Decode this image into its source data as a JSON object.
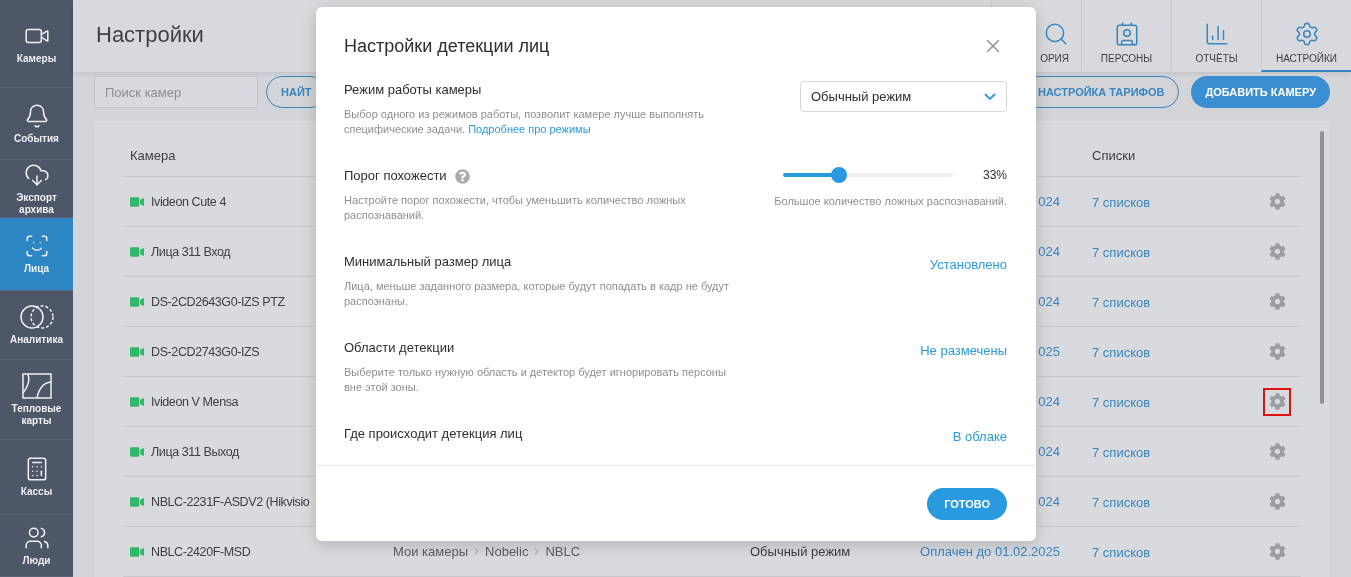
{
  "sidebar": {
    "items": [
      {
        "label": "Камеры",
        "selected": false
      },
      {
        "label": "События",
        "selected": false
      },
      {
        "label": "Экспорт архива",
        "selected": false
      },
      {
        "label": "Лица",
        "selected": true
      },
      {
        "label": "Аналитика",
        "selected": false
      },
      {
        "label": "Тепловые карты",
        "selected": false
      },
      {
        "label": "Кассы",
        "selected": false
      },
      {
        "label": "Люди",
        "selected": false
      }
    ]
  },
  "header": {
    "title": "Настройки",
    "tabs": [
      {
        "label": "ОРИЯ",
        "selected": false
      },
      {
        "label": "ПЕРСОНЫ",
        "selected": false
      },
      {
        "label": "ОТЧЁТЫ",
        "selected": false
      },
      {
        "label": "НАСТРОЙКИ",
        "selected": true
      }
    ]
  },
  "toolbar": {
    "search": {
      "placeholder": "Поиск камер"
    },
    "find_button": "НАЙТ",
    "tariff_button": "НАСТРОЙКА ТАРИФОВ",
    "add_button": "ДОБАВИТЬ КАМЕРУ"
  },
  "table": {
    "columns": [
      "Камера",
      "Списки"
    ],
    "rows": [
      {
        "camera": "Ivideon Cute 4",
        "payment": "024",
        "lists": "7 списков",
        "highlighted": false
      },
      {
        "camera": "Лица 311 Вход",
        "payment": "024",
        "lists": "7 списков",
        "highlighted": false
      },
      {
        "camera": "DS-2CD2643G0-IZS PTZ",
        "payment": "024",
        "lists": "7 списков",
        "highlighted": false
      },
      {
        "camera": "DS-2CD2743G0-IZS",
        "payment": "025",
        "lists": "7 списков",
        "highlighted": false
      },
      {
        "camera": "Ivideon V Mensa",
        "payment": "024",
        "lists": "7 списков",
        "highlighted": true
      },
      {
        "camera": "Лица 311 Выход",
        "payment": "024",
        "lists": "7 списков",
        "highlighted": false
      },
      {
        "camera": "NBLC-2231F-ASDV2 (Hikvisio",
        "payment": "024",
        "lists": "7 списков",
        "highlighted": false
      },
      {
        "camera": "NBLC-2420F-MSD",
        "path": [
          "Мои камеры",
          "Nobelic",
          "NBLC"
        ],
        "mode": "Обычный режим",
        "payment": "Оплачен до 01.02.2025",
        "lists": "7 списков",
        "highlighted": false
      }
    ]
  },
  "modal": {
    "title": "Настройки детекции лиц",
    "sections": [
      {
        "kind": "select",
        "title": "Режим работы камеры",
        "description": "Выбор одного из режимов работы, позволит камере лучше выполнять специфические задачи.",
        "link": "Подробнее про режимы",
        "value": "Обычный режим"
      },
      {
        "kind": "slider",
        "title": "Порог похожести",
        "help": true,
        "description": "Настройте порог похожести, чтобы уменьшить количество ложных распознаваний.",
        "level": 0.33,
        "reading": "33%",
        "note": "Большое количество ложных распознаваний."
      },
      {
        "kind": "link",
        "title": "Минимальный размер лица",
        "description": "Лица, меньше заданного размера, которые будут попадать в кадр не будут распознаны.",
        "value": "Установлено"
      },
      {
        "kind": "link",
        "title": "Области детекции",
        "description": "Выберите только нужную область и детектор будет игнорировать персоны вне этой зоны.",
        "value": "Не размечены"
      },
      {
        "kind": "link",
        "title": "Где происходит детекция лиц",
        "value": "В облаке"
      }
    ],
    "done_button": "ГОТОВО"
  }
}
